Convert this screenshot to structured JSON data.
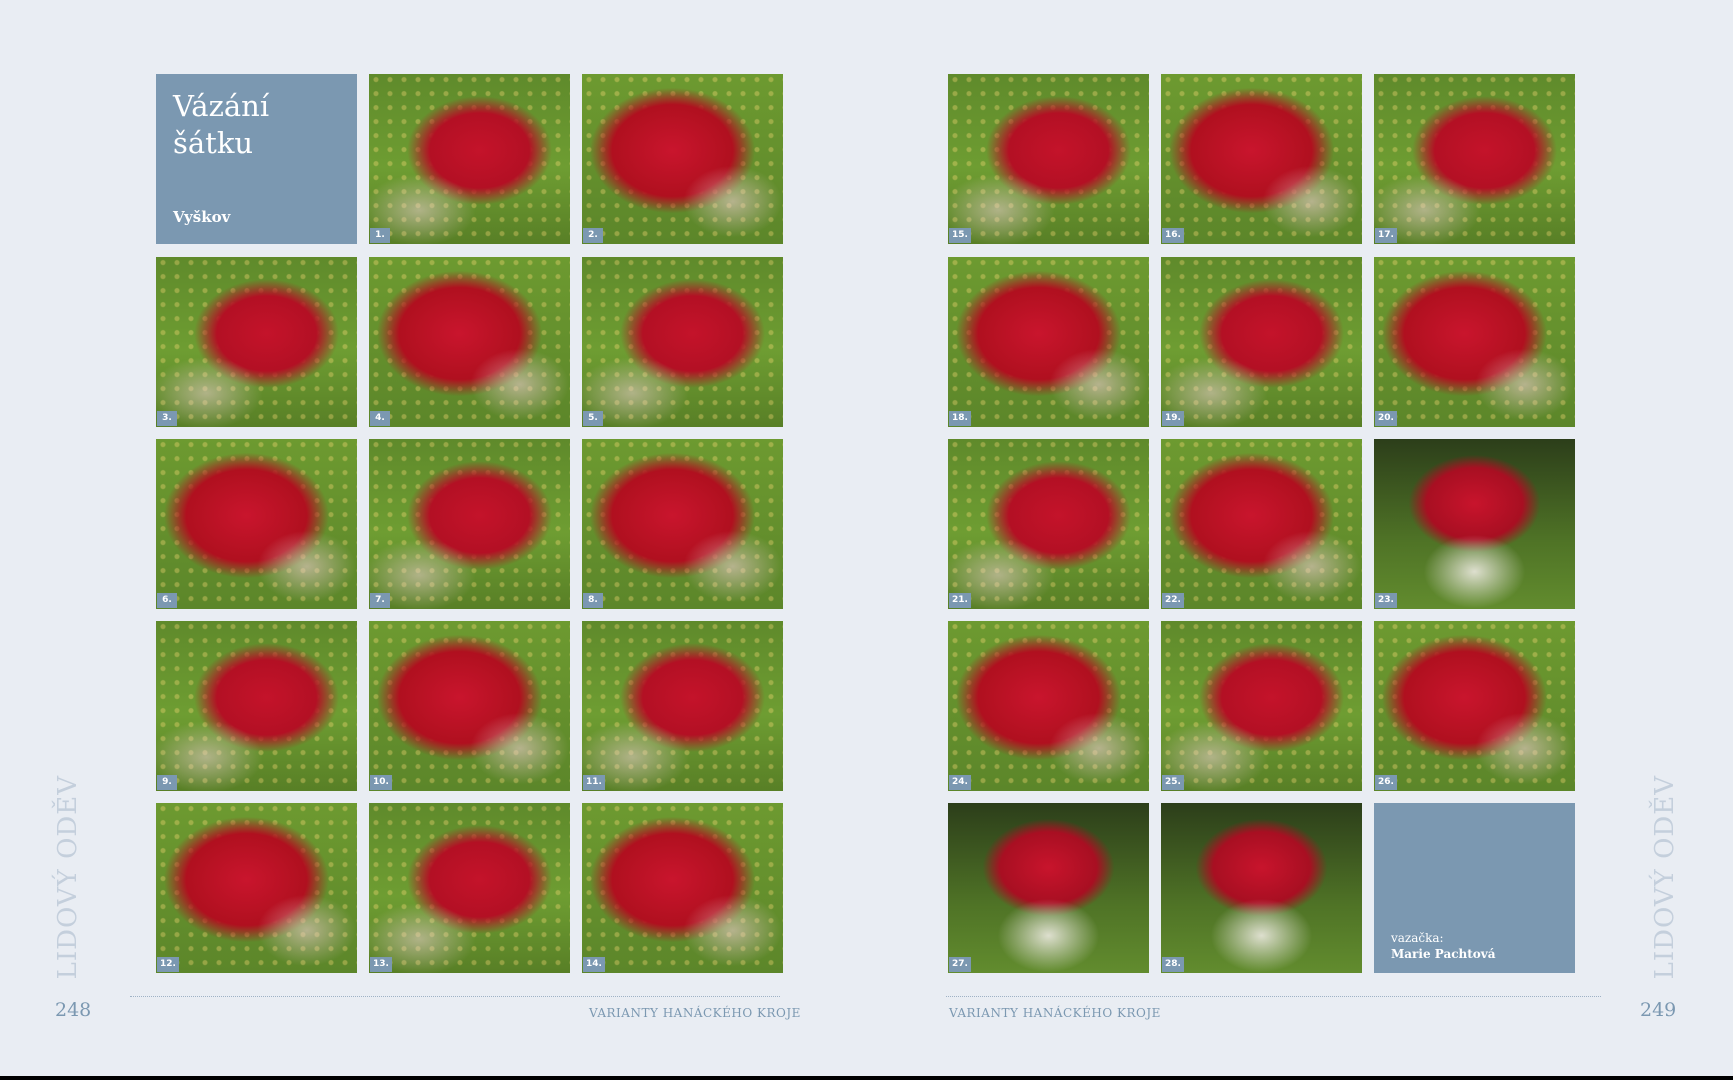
{
  "left_page": {
    "title": "Vázání šátku",
    "subtitle": "Vyškov",
    "side_label": "LIDOVÝ ODĚV",
    "page_number": "248",
    "running_footer": "VARIANTY HANÁCKÉHO KROJE"
  },
  "right_page": {
    "side_label": "LIDOVÝ ODĚV",
    "page_number": "249",
    "running_footer": "VARIANTY HANÁCKÉHO KROJE",
    "credit_role": "vazačka:",
    "credit_name": "Marie Pachtová"
  },
  "steps": [
    "1.",
    "2.",
    "3.",
    "4.",
    "5.",
    "6.",
    "7.",
    "8.",
    "9.",
    "10.",
    "11.",
    "12.",
    "13.",
    "14.",
    "15.",
    "16.",
    "17.",
    "18.",
    "19.",
    "20.",
    "21.",
    "22.",
    "23.",
    "24.",
    "25.",
    "26.",
    "27.",
    "28."
  ],
  "colors": {
    "page_background": "#e9edf3",
    "accent_blue": "#7b98b1",
    "side_label": "#c4cfdc",
    "scarf_red": "#c4132a",
    "grass_green": "#6e9d32"
  }
}
